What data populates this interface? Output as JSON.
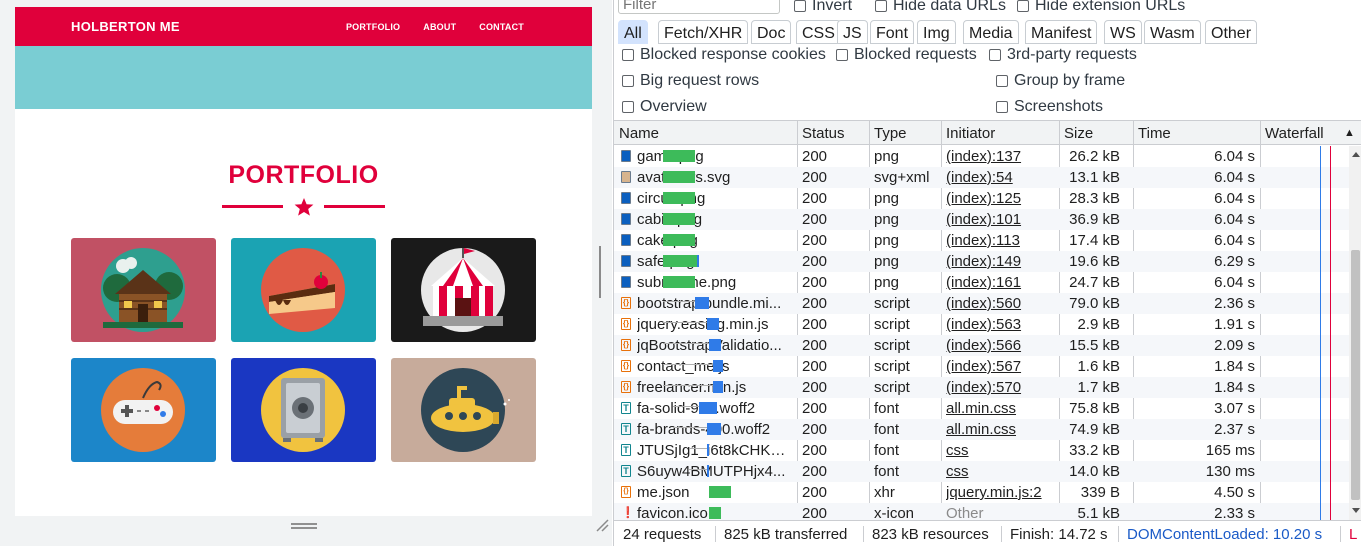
{
  "site": {
    "brand": "HOLBERTON ME",
    "nav": [
      "PORTFOLIO",
      "ABOUT",
      "CONTACT"
    ],
    "section_title": "PORTFOLIO",
    "cards": [
      {
        "image": "cabin",
        "bg": "#c15164"
      },
      {
        "image": "cake",
        "bg": "#1ba3b3"
      },
      {
        "image": "circus",
        "bg": "#1a1a1a"
      },
      {
        "image": "game",
        "bg": "#1c86c9"
      },
      {
        "image": "safe",
        "bg": "#1a37c2"
      },
      {
        "image": "submarine",
        "bg": "#c7ab9b"
      }
    ],
    "colors": {
      "brand": "#e0003b",
      "band": "#7acdd3"
    }
  },
  "devtools": {
    "filter_placeholder": "Filter",
    "invert_label": "Invert",
    "hide_data_urls_label": "Hide data URLs",
    "hide_extension_urls_label": "Hide extension URLs",
    "type_filters": [
      "All",
      "Fetch/XHR",
      "Doc",
      "CSS",
      "JS",
      "Font",
      "Img",
      "Media",
      "Manifest",
      "WS",
      "Wasm",
      "Other"
    ],
    "active_type_filter": "All",
    "blocked_response_cookies_label": "Blocked response cookies",
    "blocked_requests_label": "Blocked requests",
    "third_party_label": "3rd-party requests",
    "big_request_rows_label": "Big request rows",
    "group_by_frame_label": "Group by frame",
    "overview_label": "Overview",
    "screenshots_label": "Screenshots",
    "columns": {
      "name": "Name",
      "status": "Status",
      "type": "Type",
      "initiator": "Initiator",
      "size": "Size",
      "time": "Time",
      "waterfall": "Waterfall"
    },
    "sort_indicator": "▲",
    "requests": [
      {
        "name": "game.png",
        "status": "200",
        "type": "png",
        "initiator": "(index):137",
        "size": "26.2 kB",
        "time": "6.04 s",
        "icon": "img"
      },
      {
        "name": "avataaars.svg",
        "status": "200",
        "type": "svg+xml",
        "initiator": "(index):54",
        "size": "13.1 kB",
        "time": "6.04 s",
        "icon": "svgimg"
      },
      {
        "name": "circus.png",
        "status": "200",
        "type": "png",
        "initiator": "(index):125",
        "size": "28.3 kB",
        "time": "6.04 s",
        "icon": "img"
      },
      {
        "name": "cabin.png",
        "status": "200",
        "type": "png",
        "initiator": "(index):101",
        "size": "36.9 kB",
        "time": "6.04 s",
        "icon": "img"
      },
      {
        "name": "cake.png",
        "status": "200",
        "type": "png",
        "initiator": "(index):113",
        "size": "17.4 kB",
        "time": "6.04 s",
        "icon": "img"
      },
      {
        "name": "safe.png",
        "status": "200",
        "type": "png",
        "initiator": "(index):149",
        "size": "19.6 kB",
        "time": "6.29 s",
        "icon": "img"
      },
      {
        "name": "submarine.png",
        "status": "200",
        "type": "png",
        "initiator": "(index):161",
        "size": "24.7 kB",
        "time": "6.04 s",
        "icon": "img"
      },
      {
        "name": "bootstrap.bundle.mi...",
        "status": "200",
        "type": "script",
        "initiator": "(index):560",
        "size": "79.0 kB",
        "time": "2.36 s",
        "icon": "script"
      },
      {
        "name": "jquery.easing.min.js",
        "status": "200",
        "type": "script",
        "initiator": "(index):563",
        "size": "2.9 kB",
        "time": "1.91 s",
        "icon": "script"
      },
      {
        "name": "jqBootstrapValidatio...",
        "status": "200",
        "type": "script",
        "initiator": "(index):566",
        "size": "15.5 kB",
        "time": "2.09 s",
        "icon": "script"
      },
      {
        "name": "contact_me.js",
        "status": "200",
        "type": "script",
        "initiator": "(index):567",
        "size": "1.6 kB",
        "time": "1.84 s",
        "icon": "script"
      },
      {
        "name": "freelancer.min.js",
        "status": "200",
        "type": "script",
        "initiator": "(index):570",
        "size": "1.7 kB",
        "time": "1.84 s",
        "icon": "script"
      },
      {
        "name": "fa-solid-900.woff2",
        "status": "200",
        "type": "font",
        "initiator": "all.min.css",
        "size": "75.8 kB",
        "time": "3.07 s",
        "icon": "font"
      },
      {
        "name": "fa-brands-400.woff2",
        "status": "200",
        "type": "font",
        "initiator": "all.min.css",
        "size": "74.9 kB",
        "time": "2.37 s",
        "icon": "font"
      },
      {
        "name": "JTUSjIg1_i6t8kCHKm...",
        "status": "200",
        "type": "font",
        "initiator": "css",
        "size": "33.2 kB",
        "time": "165 ms",
        "icon": "font"
      },
      {
        "name": "S6uyw4BMUTPHjx4...",
        "status": "200",
        "type": "font",
        "initiator": "css",
        "size": "14.0 kB",
        "time": "130 ms",
        "icon": "font"
      },
      {
        "name": "me.json",
        "status": "200",
        "type": "xhr",
        "initiator": "jquery.min.js:2",
        "size": "339 B",
        "time": "4.50 s",
        "icon": "xhr"
      },
      {
        "name": "favicon.ico",
        "status": "200",
        "type": "x-icon",
        "initiator": "Other",
        "size": "5.1 kB",
        "time": "2.33 s",
        "icon": "favicon"
      }
    ],
    "statusbar": {
      "requests": "24 requests",
      "transferred": "825 kB transferred",
      "resources": "823 kB resources",
      "finish": "Finish: 14.72 s",
      "dom_content_loaded": "DOMContentLoaded: 10.20 s",
      "load": "L"
    }
  }
}
